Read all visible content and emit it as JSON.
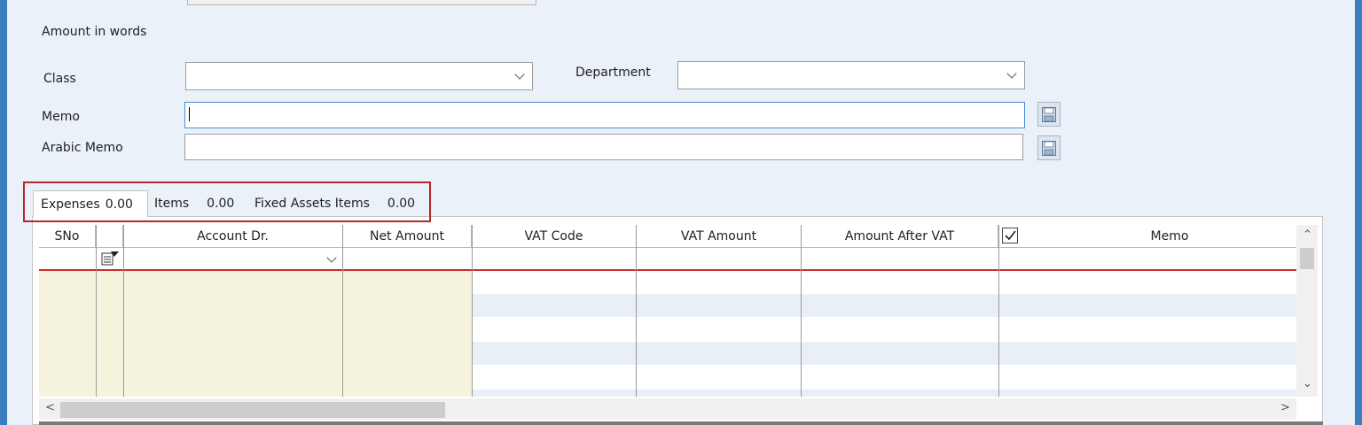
{
  "form": {
    "amount_in_words_label": "Amount in words",
    "class_label": "Class",
    "class_value": "",
    "department_label": "Department",
    "department_value": "",
    "memo_label": "Memo",
    "memo_value": "",
    "arabic_memo_label": "Arabic Memo",
    "arabic_memo_value": ""
  },
  "tabs": [
    {
      "label": "Expenses",
      "amount": "0.00",
      "active": true
    },
    {
      "label": "Items",
      "amount": "0.00",
      "active": false
    },
    {
      "label": "Fixed Assets Items",
      "amount": "0.00",
      "active": false
    }
  ],
  "grid": {
    "columns": [
      "SNo",
      "",
      "Account Dr.",
      "Net Amount",
      "VAT Code",
      "VAT Amount",
      "Amount After VAT",
      "",
      "Memo"
    ],
    "memo_checkbox_checked": true,
    "rows": []
  },
  "colors": {
    "window_border": "#3d7ebf",
    "highlight_outline": "#b22a2a",
    "editable_cell": "#f6f3dc",
    "new_row_separator": "#c8302a"
  },
  "icons": {
    "save": "save-icon",
    "chevron": "chevron-down-icon",
    "row_edit": "row-edit-icon"
  }
}
